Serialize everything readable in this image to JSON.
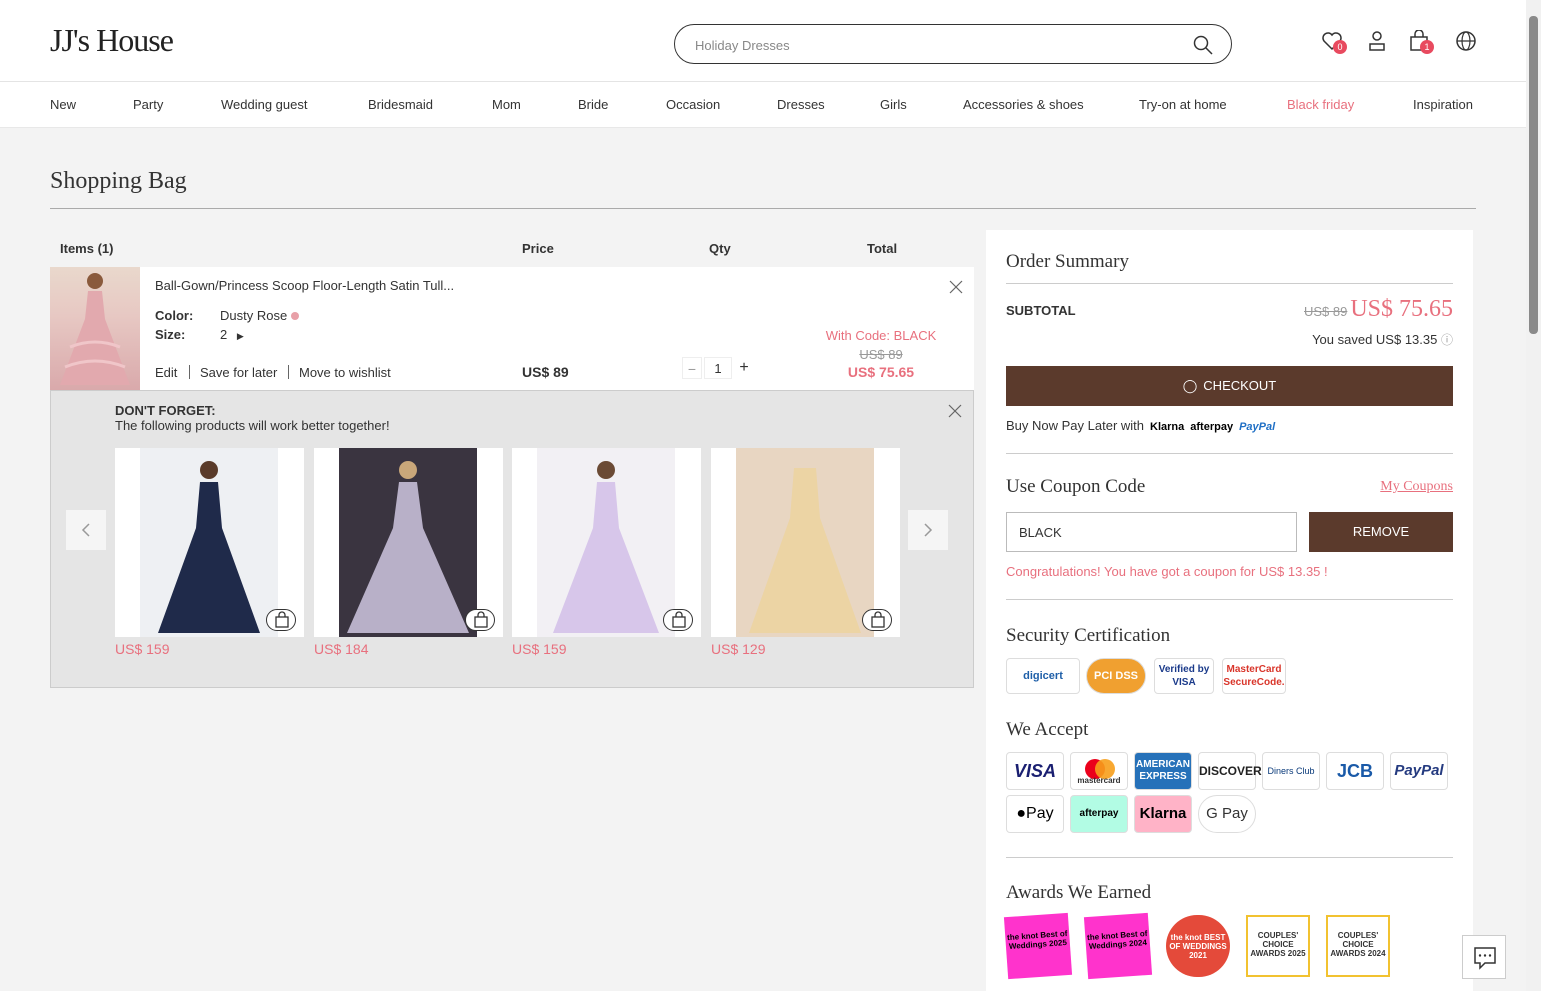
{
  "header": {
    "logo": "JJ's House",
    "search_placeholder": "Holiday Dresses",
    "wishlist_count": "0",
    "cart_count": "1"
  },
  "nav": [
    "New",
    "Party",
    "Wedding guest",
    "Bridesmaid",
    "Mom",
    "Bride",
    "Occasion",
    "Dresses",
    "Girls",
    "Accessories & shoes",
    "Try-on at home",
    "Black friday",
    "Inspiration"
  ],
  "page_title": "Shopping Bag",
  "columns": {
    "items": "Items (1)",
    "price": "Price",
    "qty": "Qty",
    "total": "Total"
  },
  "cart_item": {
    "name": "Ball-Gown/Princess Scoop Floor-Length Satin Tull...",
    "color_label": "Color:",
    "color_value": "Dusty Rose",
    "size_label": "Size:",
    "size_value": "2",
    "edit": "Edit",
    "save_later": "Save for later",
    "move_wishlist": "Move to wishlist",
    "price": "US$ 89",
    "qty": "1",
    "code_note": "With Code: BLACK",
    "old_total": "US$ 89",
    "new_total": "US$ 75.65"
  },
  "dont_forget": {
    "title": "DON'T FORGET:",
    "subtitle": "The following products will work better together!",
    "products": [
      {
        "price": "US$ 159"
      },
      {
        "price": "US$ 184"
      },
      {
        "price": "US$ 159"
      },
      {
        "price": "US$ 129"
      }
    ]
  },
  "summary": {
    "title": "Order Summary",
    "subtotal_label": "SUBTOTAL",
    "old_price": "US$ 89",
    "new_price": "US$ 75.65",
    "saved": "You saved US$ 13.35",
    "checkout": "CHECKOUT",
    "bnpl": "Buy Now Pay Later with",
    "bnpl_providers": [
      "Klarna",
      "afterpay",
      "PayPal"
    ],
    "coupon_title": "Use Coupon Code",
    "my_coupons": "My Coupons",
    "coupon_value": "BLACK",
    "remove": "REMOVE",
    "congrats": "Congratulations! You have got a coupon for US$ 13.35 !",
    "security_title": "Security Certification",
    "certs": [
      "digicert",
      "PCI DSS",
      "Verified by VISA",
      "MasterCard SecureCode."
    ],
    "accept_title": "We Accept",
    "payments": [
      "VISA",
      "mastercard",
      "AMERICAN EXPRESS",
      "DISCOVER",
      "Diners Club",
      "JCB",
      "PayPal",
      "Pay",
      "afterpay",
      "Klarna",
      "G Pay"
    ],
    "awards_title": "Awards We Earned",
    "awards": [
      "the knot Best of Weddings 2025",
      "the knot Best of Weddings 2024",
      "the knot BEST OF WEDDINGS 2021",
      "COUPLES' CHOICE AWARDS 2025",
      "COUPLES' CHOICE AWARDS 2024"
    ]
  },
  "colors": {
    "brown": "#5b3a2c",
    "pink": "#e8707e"
  }
}
